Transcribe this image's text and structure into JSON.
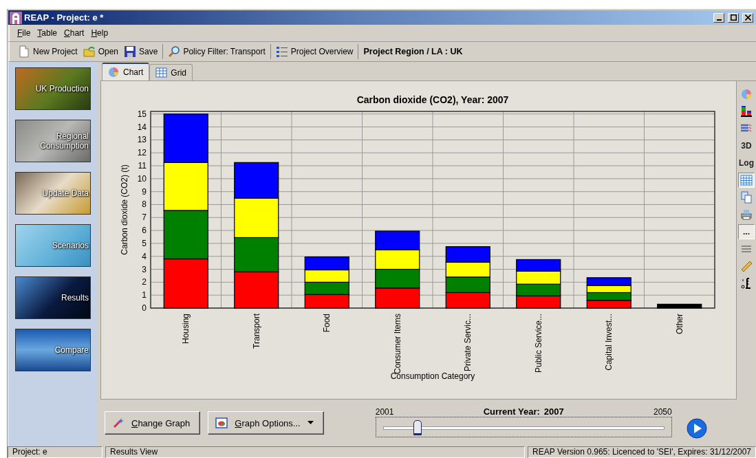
{
  "window": {
    "title": "REAP - Project: e *"
  },
  "menu": [
    "File",
    "Table",
    "Chart",
    "Help"
  ],
  "toolbar": {
    "buttons": [
      "New Project",
      "Open",
      "Save",
      "Policy Filter: Transport",
      "Project Overview"
    ],
    "region": "Project Region / LA : UK"
  },
  "sidebar": {
    "items": [
      "UK Production",
      "Regional Consumption",
      "Update Data",
      "Scenarios",
      "Results",
      "Compare"
    ]
  },
  "tabs": [
    {
      "label": "Chart",
      "selected": true
    },
    {
      "label": "Grid",
      "selected": false
    }
  ],
  "chart": {
    "chart_data": {
      "type": "bar",
      "title": "Carbon dioxide (CO2), Year: 2007",
      "xlabel": "Consumption Category",
      "ylabel": "Carbon dioxide (CO2) (t)",
      "stacked": true,
      "grid": true,
      "categories": [
        "Housing",
        "Transport",
        "Food",
        "Consumer Items",
        "Private Servic...",
        "Public Service...",
        "Capital Invest...",
        "Other"
      ],
      "ylim": [
        0,
        15.2
      ],
      "yticks": [
        0,
        1,
        2,
        3,
        4,
        5,
        6,
        7,
        8,
        9,
        10,
        11,
        12,
        13,
        14,
        15
      ],
      "series": [
        {
          "color": "#ff0000",
          "values": [
            3.8,
            2.8,
            1.05,
            1.55,
            1.2,
            0.95,
            0.6,
            null
          ]
        },
        {
          "color": "#008000",
          "values": [
            3.75,
            2.65,
            0.95,
            1.45,
            1.2,
            0.9,
            0.6,
            null
          ]
        },
        {
          "color": "#ffff00",
          "values": [
            3.7,
            3.05,
            0.95,
            1.5,
            1.15,
            1.0,
            0.55,
            null
          ]
        },
        {
          "color": "#0000ff",
          "values": [
            3.75,
            2.75,
            1.0,
            1.45,
            1.2,
            0.9,
            0.6,
            null
          ]
        },
        {
          "color": "#000000",
          "values": [
            null,
            null,
            null,
            null,
            null,
            null,
            null,
            0.3
          ]
        }
      ]
    }
  },
  "chart_tools": [
    {
      "kind": "icon",
      "on": false
    },
    {
      "kind": "icon",
      "on": false
    },
    {
      "kind": "icon",
      "on": false
    },
    {
      "kind": "text",
      "label": "3D",
      "on": false
    },
    {
      "kind": "text",
      "label": "Log",
      "on": false
    },
    {
      "kind": "icon",
      "on": true
    },
    {
      "kind": "icon",
      "on": false
    },
    {
      "kind": "icon",
      "on": false
    },
    {
      "kind": "text",
      "label": "...",
      "on": true
    },
    {
      "kind": "icon",
      "on": false
    },
    {
      "kind": "icon",
      "on": false
    },
    {
      "kind": "icon",
      "on": false
    }
  ],
  "controls": {
    "change_graph": "Change Graph",
    "graph_options": "Graph Options...",
    "year_slider": {
      "min_label": "2001",
      "caption": "Current Year:",
      "value": "2007",
      "max_label": "2050",
      "level": 0.12
    }
  },
  "status_bar": [
    "Project: e",
    "Results View",
    "REAP Version 0.965: Licenced to 'SEI', Expires: 31/12/2007"
  ]
}
